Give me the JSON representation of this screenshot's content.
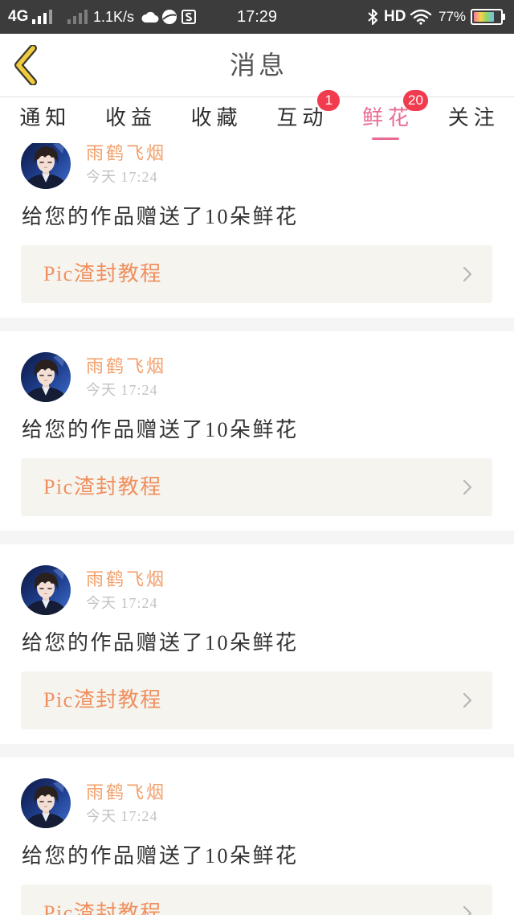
{
  "status_bar": {
    "network": "4G",
    "speed": "1.1K/s",
    "time": "17:29",
    "hd": "HD",
    "battery_percent": "77%",
    "battery_level": 0.77,
    "icons": [
      "signal-icon",
      "signal-secondary-icon",
      "cloud-icon",
      "ball-icon",
      "s-app-icon",
      "bluetooth-icon",
      "wifi-icon",
      "battery-icon"
    ]
  },
  "header": {
    "title": "消息",
    "back_icon": "back-chevron-icon"
  },
  "tabs": [
    {
      "label": "通知",
      "active": false
    },
    {
      "label": "收益",
      "active": false
    },
    {
      "label": "收藏",
      "active": false
    },
    {
      "label": "互动",
      "badge": "1",
      "active": false
    },
    {
      "label": "鲜花",
      "badge": "20",
      "active": true
    },
    {
      "label": "关注",
      "active": false
    }
  ],
  "messages": [
    {
      "name": "雨鹤飞烟",
      "time": "今天 17:24",
      "text": "给您的作品赠送了10朵鲜花",
      "work": "Pic渣封教程"
    },
    {
      "name": "雨鹤飞烟",
      "time": "今天 17:24",
      "text": "给您的作品赠送了10朵鲜花",
      "work": "Pic渣封教程"
    },
    {
      "name": "雨鹤飞烟",
      "time": "今天 17:24",
      "text": "给您的作品赠送了10朵鲜花",
      "work": "Pic渣封教程"
    },
    {
      "name": "雨鹤飞烟",
      "time": "今天 17:24",
      "text": "给您的作品赠送了10朵鲜花",
      "work": "Pic渣封教程"
    }
  ],
  "colors": {
    "status_bar": "#3c3c3c",
    "accent_pink": "#ea6b92",
    "badge_red": "#f13b4e",
    "sender_name": "#f2a06d",
    "work_title": "#f0905f",
    "message_text": "#333333",
    "timestamp": "#c2c2c2",
    "work_box": "#f5f4ef",
    "separator": "#f5f5f5",
    "back_chevron": "#f2cc3f"
  }
}
